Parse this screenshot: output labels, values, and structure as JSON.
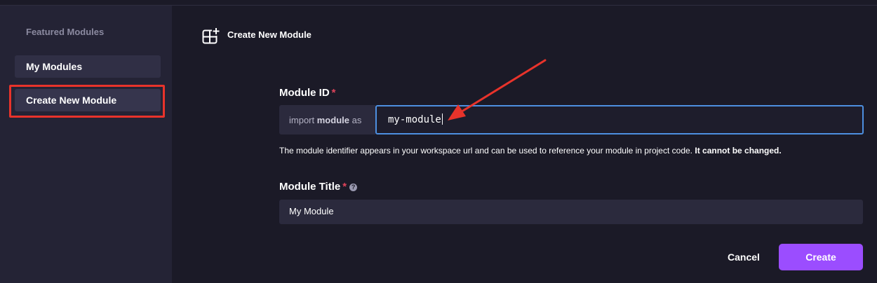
{
  "sidebar": {
    "heading": "Featured Modules",
    "items": [
      {
        "label": "My Modules"
      },
      {
        "label": "Create New Module",
        "active": true
      }
    ]
  },
  "header": {
    "title": "Create New Module",
    "icon": "grid-plus-icon"
  },
  "form": {
    "module_id": {
      "label": "Module ID",
      "required_mark": "*",
      "prefix_text_1": "import",
      "prefix_text_bold": "module",
      "prefix_text_2": "as",
      "value": "my-module",
      "focused": true
    },
    "hint": {
      "text": "The module identifier appears in your workspace url and can be used to reference your module in project code.",
      "bold": "It cannot be changed."
    },
    "module_title": {
      "label": "Module Title",
      "required_mark": "*",
      "help_icon": "question-circle-icon",
      "value": "My Module"
    }
  },
  "actions": {
    "cancel_label": "Cancel",
    "create_label": "Create"
  },
  "colors": {
    "accent": "#9b4dff",
    "annotation": "#e8332b",
    "focus_border": "#4d8fe0",
    "required": "#e0435a"
  }
}
